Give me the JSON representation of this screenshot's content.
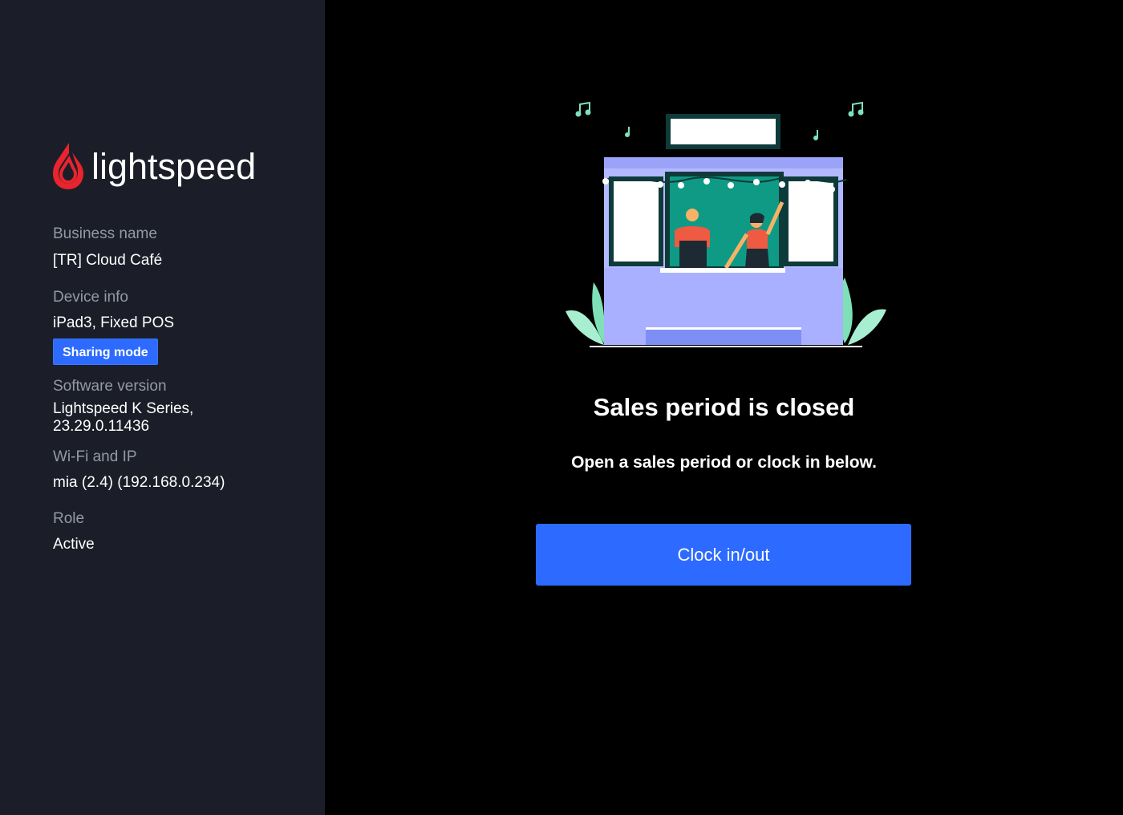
{
  "brand": {
    "name": "lightspeed",
    "icon": "lightspeed-flame-icon",
    "icon_color": "#e8242e"
  },
  "sidebar": {
    "business_name_label": "Business name",
    "business_name_value": "[TR] Cloud Café",
    "device_info_label": "Device info",
    "device_info_value": "iPad3, Fixed POS",
    "sharing_mode_badge": "Sharing mode",
    "software_version_label": "Software version",
    "software_version_value_line1": "Lightspeed K Series,",
    "software_version_value_line2": "23.29.0.11436",
    "wifi_label": "Wi-Fi and IP",
    "wifi_value": "mia (2.4) (192.168.0.234)",
    "role_label": "Role",
    "role_value": "Active"
  },
  "main": {
    "illustration": "cafe-storefront-illustration",
    "title": "Sales period is closed",
    "subtitle": "Open a sales period or clock in below.",
    "clock_button_label": "Clock in/out"
  },
  "colors": {
    "sidebar_bg": "#1b1e28",
    "main_bg": "#000000",
    "accent": "#2d6aff",
    "muted_text": "#9499a3"
  }
}
